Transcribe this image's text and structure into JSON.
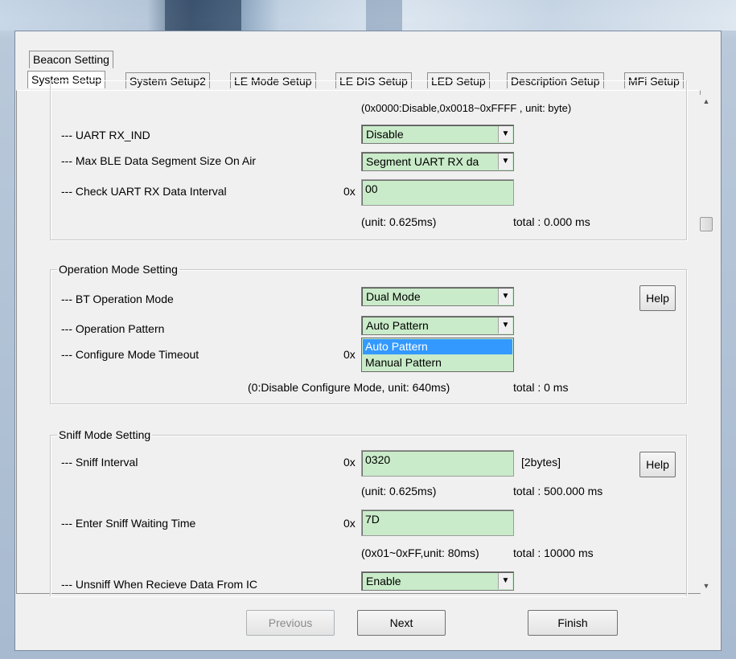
{
  "tabs_row1": [
    "Beacon Setting"
  ],
  "tabs_row2": [
    "System Setup",
    "System Setup2",
    "LE Mode Setup",
    "LE DIS Setup",
    "LED Setup",
    "Description Setup",
    "MFi Setup"
  ],
  "active_tab": "System Setup",
  "uart": {
    "note": "(0x0000:Disable,0x0018~0xFFFF , unit: byte)",
    "rx_ind_label": "--- UART RX_IND",
    "rx_ind_value": "Disable",
    "segment_label": "--- Max BLE Data Segment Size On Air",
    "segment_value": "Segment UART RX da",
    "interval_label": "--- Check UART RX Data Interval",
    "interval_prefix": "0x",
    "interval_value": "00",
    "interval_unit": "(unit: 0.625ms)",
    "interval_total": "total : 0.000 ms"
  },
  "operation": {
    "legend": "Operation Mode Setting",
    "bt_mode_label": "--- BT Operation Mode",
    "bt_mode_value": "Dual Mode",
    "help": "Help",
    "pattern_label": "--- Operation Pattern",
    "pattern_value": "Auto Pattern",
    "pattern_options": [
      "Auto Pattern",
      "Manual Pattern"
    ],
    "timeout_label": "--- Configure Mode Timeout",
    "timeout_prefix": "0x",
    "timeout_note": "(0:Disable Configure Mode, unit: 640ms)",
    "timeout_total": "total : 0 ms"
  },
  "sniff": {
    "legend": "Sniff Mode Setting",
    "interval_label": "--- Sniff Interval",
    "interval_prefix": "0x",
    "interval_value": "0320",
    "interval_bytes": "[2bytes]",
    "help": "Help",
    "interval_unit": "(unit: 0.625ms)",
    "interval_total": "total : 500.000 ms",
    "wait_label": "--- Enter Sniff Waiting Time",
    "wait_prefix": "0x",
    "wait_value": "7D",
    "wait_note": "(0x01~0xFF,unit: 80ms)",
    "wait_total": "total : 10000 ms",
    "unsniff_label": "--- Unsniff When Recieve Data From IC",
    "unsniff_value": "Enable"
  },
  "buttons": {
    "previous": "Previous",
    "next": "Next",
    "finish": "Finish"
  }
}
